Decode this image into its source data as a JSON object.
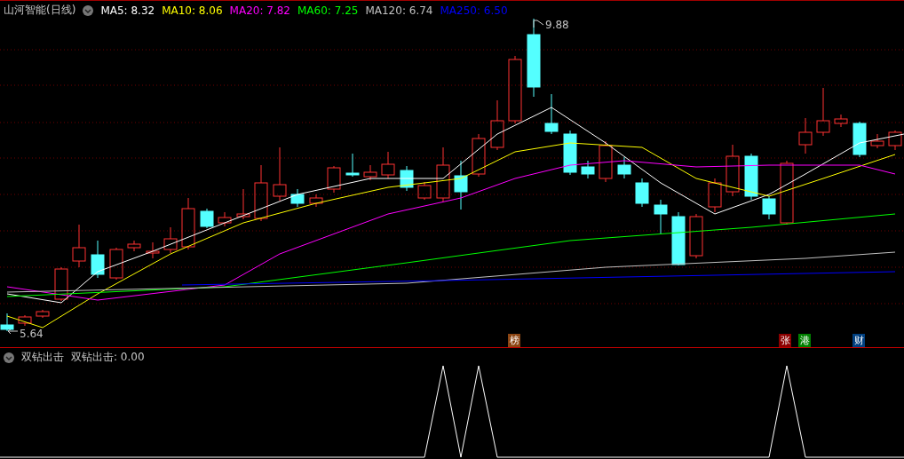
{
  "main_panel": {
    "title": "山河智能(日线)",
    "indicators": [
      {
        "label": "MA5: 8.32",
        "color": "#ffffff"
      },
      {
        "label": "MA10: 8.06",
        "color": "#ffff00"
      },
      {
        "label": "MA20: 7.82",
        "color": "#ff00ff"
      },
      {
        "label": "MA60: 7.25",
        "color": "#00ff00"
      },
      {
        "label": "MA120: 6.74",
        "color": "#c0c0c0"
      },
      {
        "label": "MA250: 6.50",
        "color": "#0000ff"
      }
    ],
    "high_label": "9.88",
    "low_label": "5.64",
    "event_markers": [
      {
        "text": "榜",
        "color": "#8b4513"
      },
      {
        "text": "张",
        "color": "#8b0000"
      },
      {
        "text": "港",
        "color": "#008000"
      },
      {
        "text": "财",
        "color": "#003f7f"
      }
    ]
  },
  "sub_panel": {
    "title": "双钻出击",
    "reading": "双钻出击: 0.00"
  }
}
